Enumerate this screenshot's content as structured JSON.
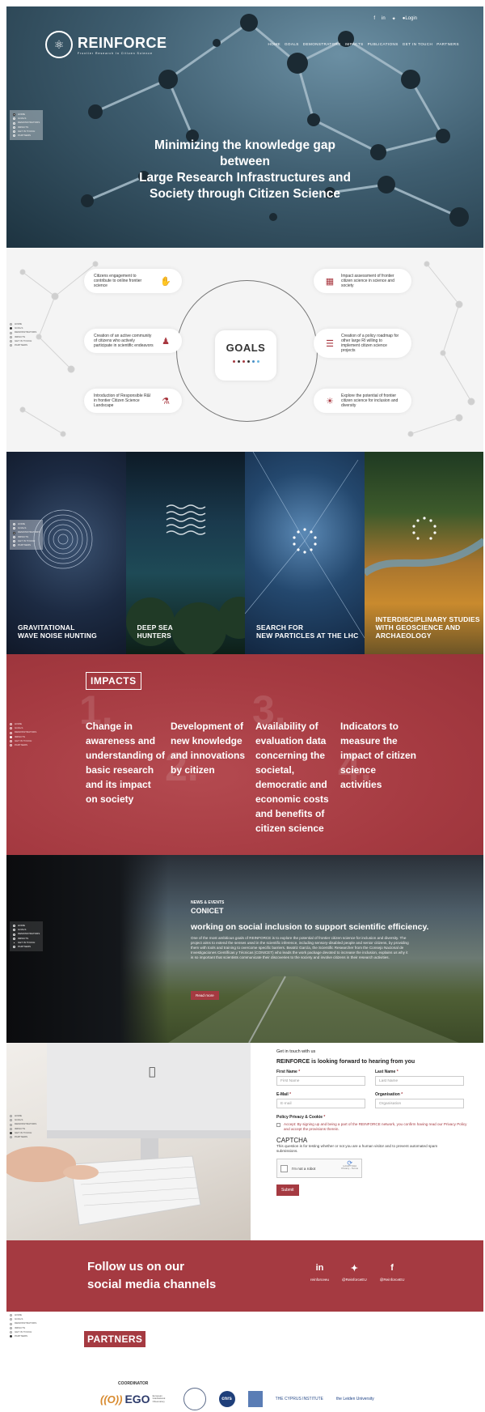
{
  "colors": {
    "accent": "#a53a41",
    "hero_dark": "#1d3340"
  },
  "hero": {
    "logo_name": "REINFORCE",
    "logo_tag": "Frontier Research In Citizen Science",
    "topbar": {
      "facebook": "f",
      "linkedin": "in",
      "twitter": "✓",
      "login": "Login"
    },
    "menu": [
      "HOME",
      "GOALS",
      "DEMONSTRATORS",
      "IMPACTS",
      "PUBLICATIONS",
      "GET IN TOUCH",
      "PARTNERS"
    ],
    "headline_1": "Minimizing the knowledge gap between",
    "headline_2": "Large Research Infrastructures and",
    "headline_3": "Society through Citizen Science"
  },
  "sidenav": [
    "HOME",
    "GOALS",
    "DEMONSTRATORS",
    "IMPACTS",
    "GET IN TOUCH",
    "PARTNERS"
  ],
  "goals": {
    "title": "GOALS",
    "items": [
      {
        "text": "Citizens engagement to contribute to online frontier science",
        "icon": "hand-icon"
      },
      {
        "text": "Creation of an active community of citizens who actively participate in scientific endeavors",
        "icon": "community-icon"
      },
      {
        "text": "Introduction of Responsible R&I in frontier Citizen Science Landscape",
        "icon": "flask-icon"
      },
      {
        "text": "Impact assessment of frontier citizen science in science and society",
        "icon": "document-icon"
      },
      {
        "text": "Creation of a policy roadmap for other large RI willing to implement citizen science projects",
        "icon": "roadmap-icon"
      },
      {
        "text": "Explore the potential of frontier citizen science for inclusion and diversity",
        "icon": "lightbulb-icon"
      }
    ]
  },
  "demonstrators": [
    {
      "label_1": "GRAVITATIONAL",
      "label_2": "WAVE NOISE HUNTING"
    },
    {
      "label_1": "DEEP SEA",
      "label_2": "HUNTERS"
    },
    {
      "label_1": "SEARCH FOR",
      "label_2": "NEW PARTICLES AT THE LHC"
    },
    {
      "label_1": "INTERDISCIPLINARY STUDIES",
      "label_2": "WITH GEOSCIENCE AND",
      "label_3": "ARCHAEOLOGY"
    }
  ],
  "impacts": {
    "title": "IMPACTS",
    "items": [
      {
        "num": "1.",
        "text": "Change in awareness and understanding of basic research and its impact on society"
      },
      {
        "num": "2.",
        "text": "Development of new knowledge and innovations by citizen"
      },
      {
        "num": "3.",
        "text": "Availability of evaluation data concerning the societal, democratic and economic costs and benefits of citizen science"
      },
      {
        "num": "4.",
        "text": "Indicators to measure the impact of citizen science activities"
      }
    ]
  },
  "news": {
    "kicker": "NEWS & EVENTS",
    "title": "CONICET",
    "headline": "working on social inclusion to support scientific efficiency.",
    "body": "One of the most ambitious goals of REINFORCE is to explore the potential of frontier citizen science for inclusion and diversity. The project aims to extend the senses used in the scientific inference, including sensory-disabled people and senior citizens, by providing them with tools and training to overcome specific barriers. Beatriz García, the Scientific Researcher from the Consejo Nacional de Investigaciones Científicas y Técnicas (CONICET) who leads the work package devoted to increase the inclusion, explains us why it is so important that scientists communicate their discoveries to the society and involve citizens in their research activities.",
    "button": "Read more"
  },
  "contact": {
    "small": "Get in touch with us",
    "lead": "REINFORCE is looking forward to hearing from you",
    "first_name_label": "First Name",
    "first_name_ph": "First Name",
    "last_name_label": "Last Name",
    "last_name_ph": "Last Name",
    "email_label": "E-Mail",
    "email_ph": "E-mail",
    "org_label": "Organisation",
    "org_ph": "Organisation",
    "policy_label": "Policy Privacy & Cookie",
    "policy_text": "Accept: By signing up and being a part of the REINFORCE network, you confirm having read our Privacy Policy and accept the provisions therein.",
    "captcha_title": "CAPTCHA",
    "captcha_desc": "This question is for testing whether or not you are a human visitor and to prevent automated spam submissions.",
    "recaptcha_label": "I'm not a robot",
    "recaptcha_brand": "reCAPTCHA",
    "recaptcha_terms": "Privacy - Terms",
    "submit": "Submit"
  },
  "social": {
    "title_1": "Follow us on our",
    "title_2": "social media channels",
    "channels": [
      {
        "glyph": "in",
        "handle": "reinforceeu",
        "icon": "linkedin-icon"
      },
      {
        "glyph": "✉",
        "handle": "@ReinforceEU",
        "icon": "twitter-icon"
      },
      {
        "glyph": "f",
        "handle": "@ReinforceEU",
        "icon": "facebook-icon"
      }
    ]
  },
  "partners": {
    "title": "PARTNERS",
    "coordinator": "COORDINATOR",
    "ego_mark": "((O))",
    "ego_name": "EGO",
    "ego_sub": "European Gravitational Observatory",
    "logos": [
      "cnrs",
      "Sorbonne",
      "THE CYPRUS INSTITUTE",
      "the Leiden University"
    ]
  }
}
